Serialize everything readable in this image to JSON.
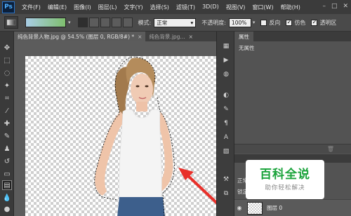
{
  "app": {
    "logo": "Ps"
  },
  "menu": [
    "文件(F)",
    "编辑(E)",
    "图像(I)",
    "图层(L)",
    "文字(Y)",
    "选择(S)",
    "滤镜(T)",
    "3D(D)",
    "视图(V)",
    "窗口(W)",
    "帮助(H)"
  ],
  "window_controls": [
    "–",
    "□",
    "✕"
  ],
  "options": {
    "mode_label": "模式:",
    "mode_value": "正常",
    "opacity_label": "不透明度:",
    "opacity_value": "100%",
    "reverse_label": "反向",
    "dither_label": "仿色",
    "transparency_label": "透明区",
    "gradient_colors": [
      "#a9cde6",
      "#7fbf6e"
    ]
  },
  "tabs": [
    {
      "label": "纯色背景人物.jpg @ 54.5% (图层 0, RGB/8#) *",
      "close": "×"
    },
    {
      "label": "纯色背景.jpg...",
      "close": "×"
    }
  ],
  "properties_panel": {
    "tab_label": "属性",
    "body_text": "无属性"
  },
  "layers_panel": {
    "blend_mode": "正常",
    "lock_label": "锁定",
    "layer_name": "图层 0"
  },
  "watermark": {
    "title": "百科全说",
    "subtitle": "助你轻松解决"
  },
  "colors": {
    "annotation_arrow": "#e8302a",
    "selection": "#000000"
  }
}
